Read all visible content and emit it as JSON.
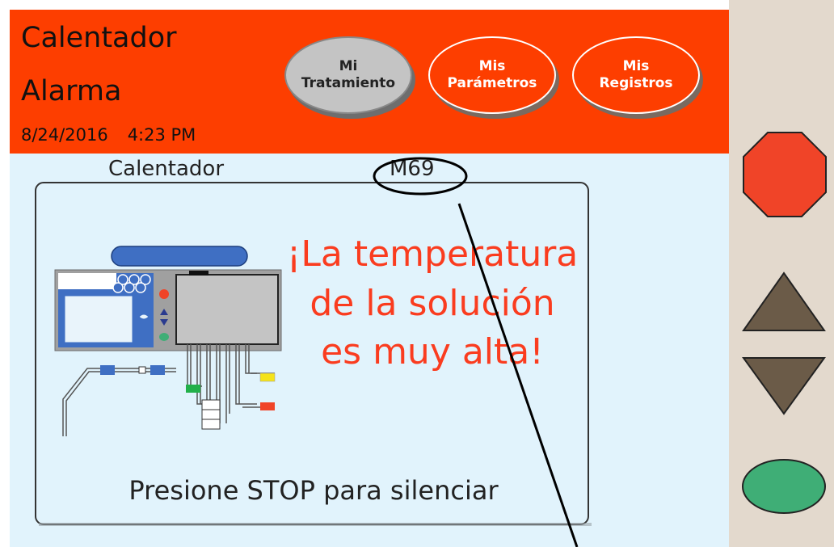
{
  "header": {
    "title_line1": "Calentador",
    "title_line2": "Alarma",
    "date": "8/24/2016",
    "time": "4:23 PM"
  },
  "nav": {
    "tabs": [
      {
        "line1": "Mi",
        "line2": "Tratamiento",
        "active": true
      },
      {
        "line1": "Mis",
        "line2": "Parámetros",
        "active": false
      },
      {
        "line1": "Mis",
        "line2": "Registros",
        "active": false
      }
    ]
  },
  "alarm": {
    "section_label": "Calentador",
    "code": "M69",
    "message_lines": [
      "¡La temperatura",
      "de la solución",
      "es muy alta!"
    ],
    "instruction": "Presione STOP para silenciar"
  },
  "side_buttons": [
    {
      "name": "stop-button",
      "icon": "stop-octagon-icon",
      "color": "#f04428"
    },
    {
      "name": "up-arrow-button",
      "icon": "triangle-up-icon",
      "color": "#6b5b48"
    },
    {
      "name": "down-arrow-button",
      "icon": "triangle-down-icon",
      "color": "#6b5b48"
    },
    {
      "name": "go-button",
      "icon": "green-oval-icon",
      "color": "#3fae76"
    }
  ],
  "colors": {
    "header_bg": "#fd3e00",
    "screen_bg": "#e1f3fc",
    "side_panel_bg": "#e3d9cd",
    "alarm_text": "#fa3c1f"
  }
}
